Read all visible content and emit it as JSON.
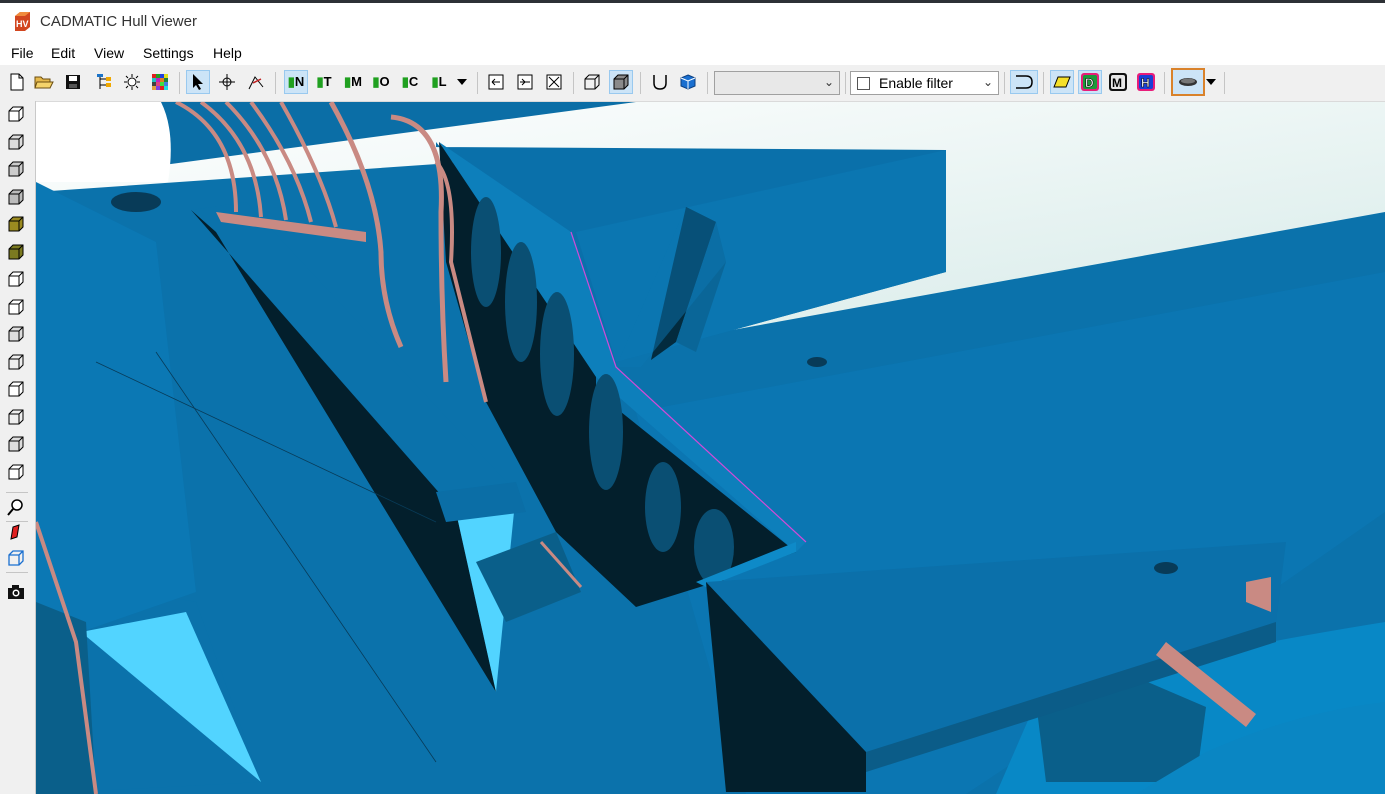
{
  "window": {
    "title": "CADMATIC Hull Viewer",
    "logo_text": "HV"
  },
  "menu": [
    "File",
    "Edit",
    "View",
    "Settings",
    "Help"
  ],
  "toolbar": {
    "letter_buttons": [
      "N",
      "T",
      "M",
      "O",
      "C",
      "L"
    ],
    "combo_value": "",
    "filter_label": "Enable filter",
    "filter_checked": false,
    "badge_buttons": [
      "D",
      "M",
      "H"
    ]
  },
  "sidebar": {
    "view_cube_count": 14
  },
  "colors": {
    "model_blue": "#0a70aa",
    "deck_blue": "#0b72ab",
    "dark_shadow": "#031f2c",
    "light_cyan": "#52d4ff",
    "frame_pink": "#c98a83",
    "highlight_orange": "#d9822b"
  }
}
